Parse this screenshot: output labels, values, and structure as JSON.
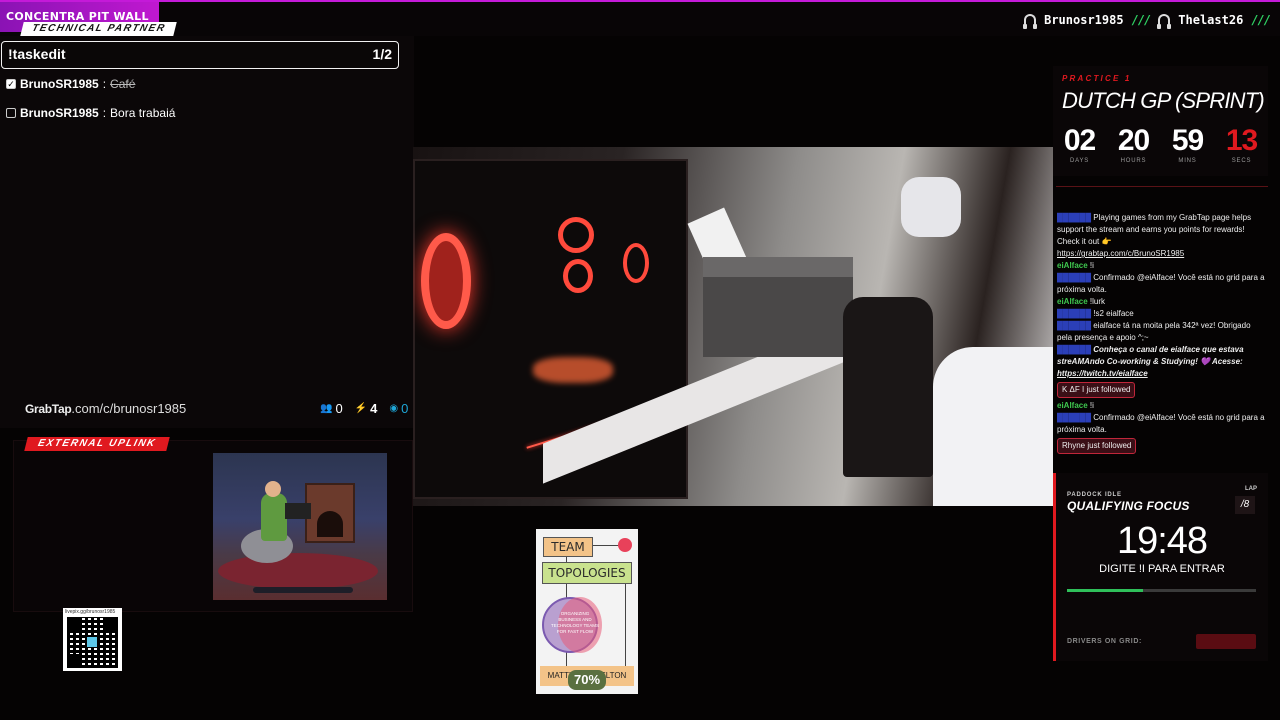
{
  "topbar": {
    "brand": "CONCENTRA PIT WALL",
    "tech_partner": "TECHNICAL PARTNER",
    "hosts": [
      "Brunosr1985",
      "Thelast26"
    ],
    "separator": "///"
  },
  "tasks": {
    "command": "!taskedit",
    "count": "1/2",
    "items": [
      {
        "user": "BrunoSR1985",
        "text": "Café",
        "done": true
      },
      {
        "user": "BrunoSR1985",
        "text": "Bora trabaiá",
        "done": false
      }
    ]
  },
  "grabtap": {
    "logo": "GrabTap",
    "url": ".com/c/brunosr1985",
    "viewers": "0",
    "bolts": "4",
    "points": "0"
  },
  "uplink": {
    "tag": "EXTERNAL UPLINK"
  },
  "qr": {
    "url": "livepix.gg/brunosr1985"
  },
  "book": {
    "title_1": "TEAM",
    "title_2": "TOPOLOGIES",
    "subtitle": "ORGANIZING BUSINESS AND TECHNOLOGY TEAMS FOR FAST FLOW",
    "authors": "MATTHEW SKELTON",
    "progress": "70%"
  },
  "session": {
    "label": "PRACTICE 1",
    "title": "DUTCH GP (SPRINT)",
    "countdown": [
      {
        "value": "02",
        "label": "DAYS"
      },
      {
        "value": "20",
        "label": "HOURS"
      },
      {
        "value": "59",
        "label": "MINS"
      },
      {
        "value": "13",
        "label": "SECS"
      }
    ]
  },
  "chat": {
    "line1": "Playing games from my GrabTap page helps support the stream and earns you points for rewards! Check it out 👉",
    "link1": "https://grabtap.com/c/BrunoSR1985",
    "m2_user": "eiAlface",
    "m2_text": "!i",
    "m3_text": "Confirmado @eiAlface! Você está no grid para a próxima volta.",
    "m4_user": "eiAlface",
    "m4_text": "!lurk",
    "m5_text": "!s2 eialface",
    "m6_text": "eialface tá na moita pela 342ª vez! Obrigado pela presença e apoio ^;~",
    "m7_text": "Conheça o canal de eialface que estava streAMAndo Co-working & Studying! 💜 Acesse:",
    "link2": "https://twitch.tv/eialface",
    "follow1": "K ΔF I just followed",
    "m8_user": "eiAlface",
    "m8_text": "!i",
    "m9_text": "Confirmado @eiAlface! Você está no grid para a próxima volta.",
    "follow2": "Rhyne just followed"
  },
  "qualifying": {
    "paddock": "PADDOCK IDLE",
    "title": "QUALIFYING FOCUS",
    "lap_label": "LAP",
    "lap": "/8",
    "time": "19:48",
    "cta": "DIGITE !I PARA ENTRAR",
    "progress": 0.4,
    "drivers_label": "DRIVERS ON GRID:"
  },
  "colors": {
    "accent_purple": "#c018d0",
    "accent_red": "#e0191f",
    "accent_green": "#2fd063"
  },
  "icons": [
    "headphones-icon",
    "viewers-icon",
    "bolt-icon",
    "points-icon",
    "checkbox-icon"
  ]
}
